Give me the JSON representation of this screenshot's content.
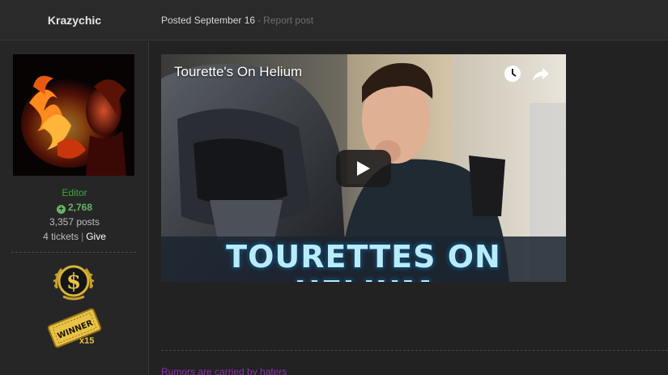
{
  "post": {
    "author": "Krazychic",
    "posted_label": "Posted September 16",
    "separator": "·",
    "report_label": "Report post"
  },
  "author_info": {
    "group": "Editor",
    "reputation": "2,768",
    "posts": "3,357 posts",
    "tickets": "4 tickets",
    "tickets_separator": "|",
    "give_label": "Give",
    "badges": [
      {
        "icon": "dollar-coin-icon"
      },
      {
        "icon": "winner-ticket-icon",
        "label": "WINNER",
        "count": "x15"
      }
    ]
  },
  "video": {
    "title": "Tourette's On Helium",
    "overlay_text": "TOURETTES ON HELIUM",
    "icons": [
      "watch-later-icon",
      "share-icon",
      "play-icon"
    ]
  },
  "signature": {
    "text": "Rumors are carried by haters"
  },
  "colors": {
    "background": "#222222",
    "header": "#2a2a2a",
    "group_green": "#3fa53f",
    "reputation_green": "#66b366",
    "signature_purple": "#8c2fb0",
    "badge_gold": "#e8c347"
  }
}
